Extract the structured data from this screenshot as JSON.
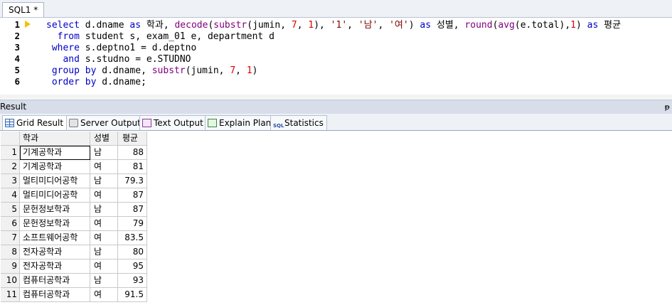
{
  "editor": {
    "tab_label": "SQL1 *",
    "line_numbers": [
      "1",
      "2",
      "3",
      "4",
      "5",
      "6"
    ]
  },
  "result_panel": {
    "title": "Result",
    "pin": "ᵽ",
    "tabs": [
      {
        "label": "Grid Result",
        "icon": "grid-icon"
      },
      {
        "label": "Server Output",
        "icon": "server-output-icon"
      },
      {
        "label": "Text Output",
        "icon": "text-output-icon"
      },
      {
        "label": "Explain Plan",
        "icon": "explain-plan-icon"
      },
      {
        "label": "Statistics",
        "icon": "statistics-icon"
      }
    ],
    "statistics_icon_text": "SQL"
  },
  "grid": {
    "columns": [
      "학과",
      "성별",
      "평균"
    ],
    "rows": [
      {
        "n": "1",
        "dept": "기계공학과",
        "gender": "남",
        "avg": "88"
      },
      {
        "n": "2",
        "dept": "기계공학과",
        "gender": "여",
        "avg": "81"
      },
      {
        "n": "3",
        "dept": "멀티미디어공학",
        "gender": "남",
        "avg": "79.3"
      },
      {
        "n": "4",
        "dept": "멀티미디어공학",
        "gender": "여",
        "avg": "87"
      },
      {
        "n": "5",
        "dept": "문헌정보학과",
        "gender": "남",
        "avg": "87"
      },
      {
        "n": "6",
        "dept": "문헌정보학과",
        "gender": "여",
        "avg": "79"
      },
      {
        "n": "7",
        "dept": "소프트웨어공학",
        "gender": "여",
        "avg": "83.5"
      },
      {
        "n": "8",
        "dept": "전자공학과",
        "gender": "남",
        "avg": "80"
      },
      {
        "n": "9",
        "dept": "전자공학과",
        "gender": "여",
        "avg": "95"
      },
      {
        "n": "10",
        "dept": "컴퓨터공학과",
        "gender": "남",
        "avg": "93"
      },
      {
        "n": "11",
        "dept": "컴퓨터공학과",
        "gender": "여",
        "avg": "91.5"
      }
    ]
  },
  "code": {
    "l1": {
      "t1": "select",
      "t2": " d.dname ",
      "t3": "as",
      "t4": " 학과, ",
      "t5": "decode",
      "t6": "(",
      "t7": "substr",
      "t8": "(jumin, ",
      "t9": "7",
      "t10": ", ",
      "t11": "1",
      "t12": "), ",
      "t13": "'1'",
      "t14": ", ",
      "t15": "'남'",
      "t16": ", ",
      "t17": "'여'",
      "t18": ") ",
      "t19": "as",
      "t20": " 성별, ",
      "t21": "round",
      "t22": "(",
      "t23": "avg",
      "t24": "(e.total),",
      "t25": "1",
      "t26": ") ",
      "t27": "as",
      "t28": " 평균"
    },
    "l2": {
      "t1": "  ",
      "t2": "from",
      "t3": " student s, exam_01 e, department d"
    },
    "l3": {
      "t1": " ",
      "t2": "where",
      "t3": " s.deptno1 = d.deptno"
    },
    "l4": {
      "t1": "   ",
      "t2": "and",
      "t3": " s.studno = e.STUDNO"
    },
    "l5": {
      "t1": " ",
      "t2": "group by",
      "t3": " d.dname, ",
      "t4": "substr",
      "t5": "(jumin, ",
      "t6": "7",
      "t7": ", ",
      "t8": "1",
      "t9": ")"
    },
    "l6": {
      "t1": " ",
      "t2": "order by",
      "t3": " d.dname;"
    }
  }
}
